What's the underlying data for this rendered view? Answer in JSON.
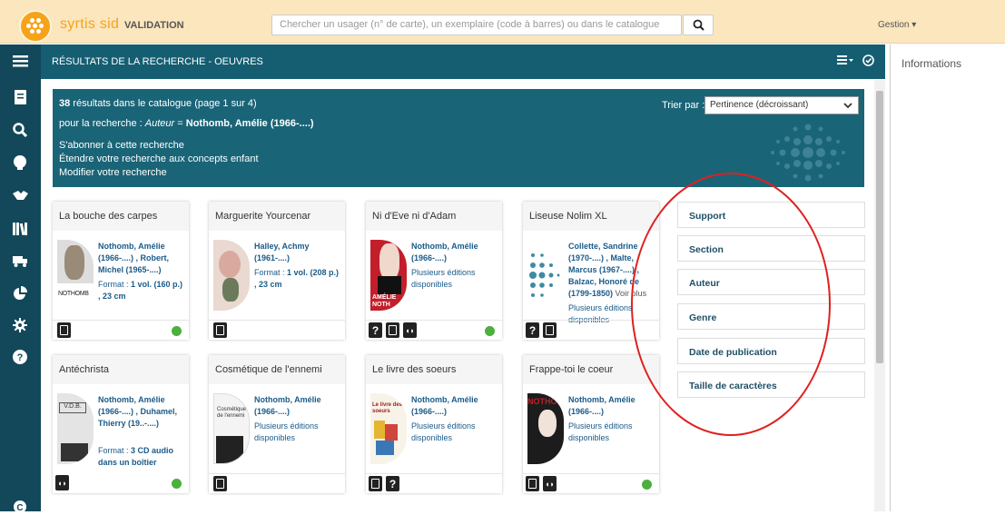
{
  "app": {
    "brand": "syrtis sid",
    "tag": "VALIDATION",
    "search_placeholder": "Chercher un usager (n° de carte), un exemplaire (code à barres) ou dans le catalogue",
    "gestion_label": "Gestion ▾"
  },
  "header": {
    "title": "RÉSULTATS DE LA RECHERCHE - OEUVRES"
  },
  "info_panel": {
    "title": "Informations"
  },
  "banner": {
    "count": "38",
    "count_suffix": " résultats dans le catalogue (page 1 sur 4)",
    "query_prefix": "pour la recherche : ",
    "query_field": "Auteur",
    "query_eq": " = ",
    "query_value": "Nothomb, Amélie (1966-....)",
    "subscribe": "S'abonner à cette recherche",
    "extend": "Étendre votre recherche aux concepts enfant",
    "modify": "Modifier votre recherche",
    "sort_label": "Trier par :",
    "sort_value": "Pertinence (décroissant)"
  },
  "cards": [
    {
      "title": "La bouche des carpes",
      "author": "Nothomb, Amélie (1966-....) , Robert, Michel (1965-....)",
      "fmt1": "Format : ",
      "fmt_bold": "1 vol. (160 p.) , 23 cm",
      "cover_text": "NOTHOMB"
    },
    {
      "title": "Marguerite Yourcenar",
      "author": "Halley, Achmy (1961-....)",
      "fmt1": "Format : ",
      "fmt_bold": "1 vol. (208 p.) , 23 cm"
    },
    {
      "title": "Ni d'Eve ni d'Adam",
      "author": "Nothomb, Amélie (1966-....)",
      "fmt1": "Plusieurs éditions disponibles",
      "cover_text": "AMÉLIE NOTH"
    },
    {
      "title": "Liseuse Nolim XL",
      "author": "Collette, Sandrine (1970-....) , Malte, Marcus (1967-....) , Balzac, Honoré de (1799-1850)",
      "more": " Voir plus",
      "fmt1": "Plusieurs éditions disponibles"
    },
    {
      "title": "Antéchrista",
      "author": "Nothomb, Amélie (1966-....) , Duhamel, Thierry (19..-....)",
      "fmt1": "Format : ",
      "fmt_bold": "3 CD audio dans un boîtier",
      "cover_text": "V.D.B."
    },
    {
      "title": "Cosmétique de l'ennemi",
      "author": "Nothomb, Amélie (1966-....)",
      "fmt1": "Plusieurs éditions disponibles",
      "cover_text": "Cosmétique de l'ennemi"
    },
    {
      "title": "Le livre des soeurs",
      "author": "Nothomb, Amélie (1966-....)",
      "fmt1": "Plusieurs éditions disponibles",
      "cover_text": "Le livre des soeurs"
    },
    {
      "title": "Frappe-toi le coeur",
      "author": "Nothomb, Amélie (1966-....)",
      "fmt1": "Plusieurs éditions disponibles",
      "cover_text": "NOTHO"
    }
  ],
  "facets": [
    "Support",
    "Section",
    "Auteur",
    "Genre",
    "Date de publication",
    "Taille de caractères"
  ],
  "colors": {
    "accent": "#155e72",
    "topbar": "#fbe6bd",
    "available": "#4caf3e",
    "annotation": "#e02020"
  }
}
